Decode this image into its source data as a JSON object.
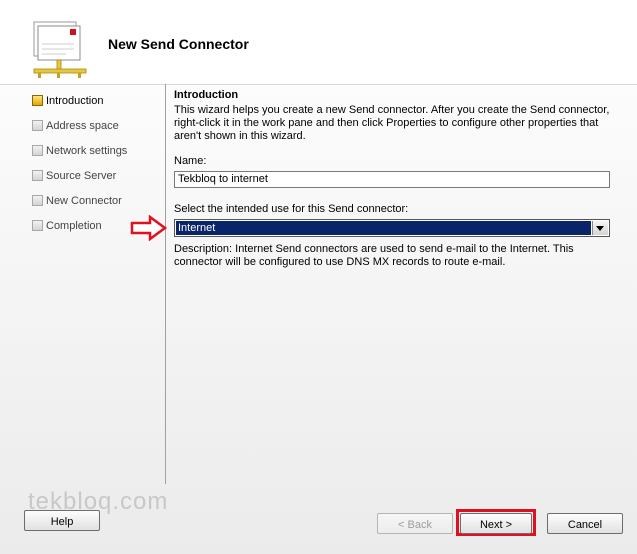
{
  "header": {
    "title": "New Send Connector"
  },
  "steps": [
    {
      "label": "Introduction",
      "active": true
    },
    {
      "label": "Address space",
      "active": false
    },
    {
      "label": "Network settings",
      "active": false
    },
    {
      "label": "Source Server",
      "active": false
    },
    {
      "label": "New Connector",
      "active": false
    },
    {
      "label": "Completion",
      "active": false
    }
  ],
  "content": {
    "section_title": "Introduction",
    "intro_text": "This wizard helps you create a new Send connector. After you create the Send connector, right-click it in the work pane and then click Properties to configure other properties that aren't shown in this wizard.",
    "name_label": "Name:",
    "name_value": "Tekbloq to internet",
    "use_label": "Select the intended use for this Send connector:",
    "use_selected": "Internet",
    "description": "Description: Internet Send connectors are used to send e-mail to the Internet. This connector will be configured to use DNS MX records to route e-mail."
  },
  "watermark": "tekbloq.com",
  "buttons": {
    "help": "Help",
    "back": "< Back",
    "next": "Next >",
    "cancel": "Cancel"
  },
  "colors": {
    "selection": "#0a246a",
    "highlight": "#e01020",
    "active_step": "#e0a800"
  },
  "icons": {
    "wizard": "send-connector-wizard-icon",
    "annotation": "red-arrow-icon"
  }
}
